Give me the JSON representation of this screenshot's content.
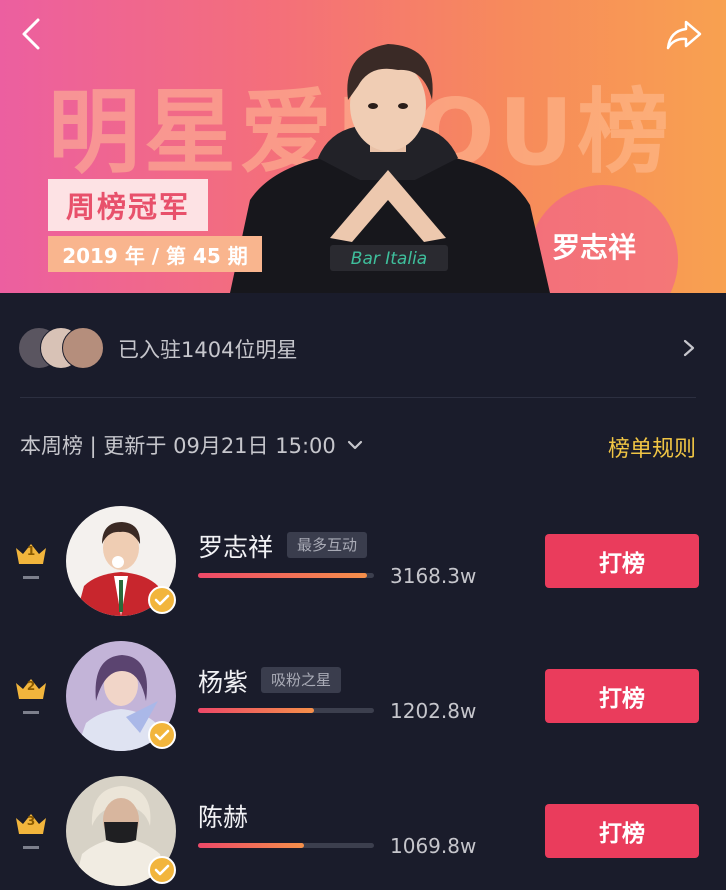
{
  "banner": {
    "title_text": "明星爱DOU榜",
    "champion_tag": "周榜冠军",
    "period": "2019 年 / 第 45 期",
    "winner_name": "罗志祥"
  },
  "stars": {
    "joined_text": "已入驻1404位明星"
  },
  "week": {
    "label": "本周榜 | 更新于 09月21日 15:00",
    "rules_link": "榜单规则"
  },
  "ranking": [
    {
      "rank": "1",
      "name": "罗志祥",
      "badge": "最多互动",
      "score": "3168.3w",
      "progress": 0.96,
      "button": "打榜"
    },
    {
      "rank": "2",
      "name": "杨紫",
      "badge": "吸粉之星",
      "score": "1202.8w",
      "progress": 0.66,
      "button": "打榜"
    },
    {
      "rank": "3",
      "name": "陈赫",
      "badge": "",
      "score": "1069.8w",
      "progress": 0.6,
      "button": "打榜"
    }
  ],
  "colors": {
    "background": "#1a1c2b",
    "accent_button": "#ea3c5c",
    "rules_link": "#f0c544",
    "crown": "#f2b53c"
  },
  "icons": [
    "back-icon",
    "share-icon",
    "chevron-right-icon",
    "chevron-down-icon",
    "crown-icon",
    "verified-check-icon"
  ]
}
